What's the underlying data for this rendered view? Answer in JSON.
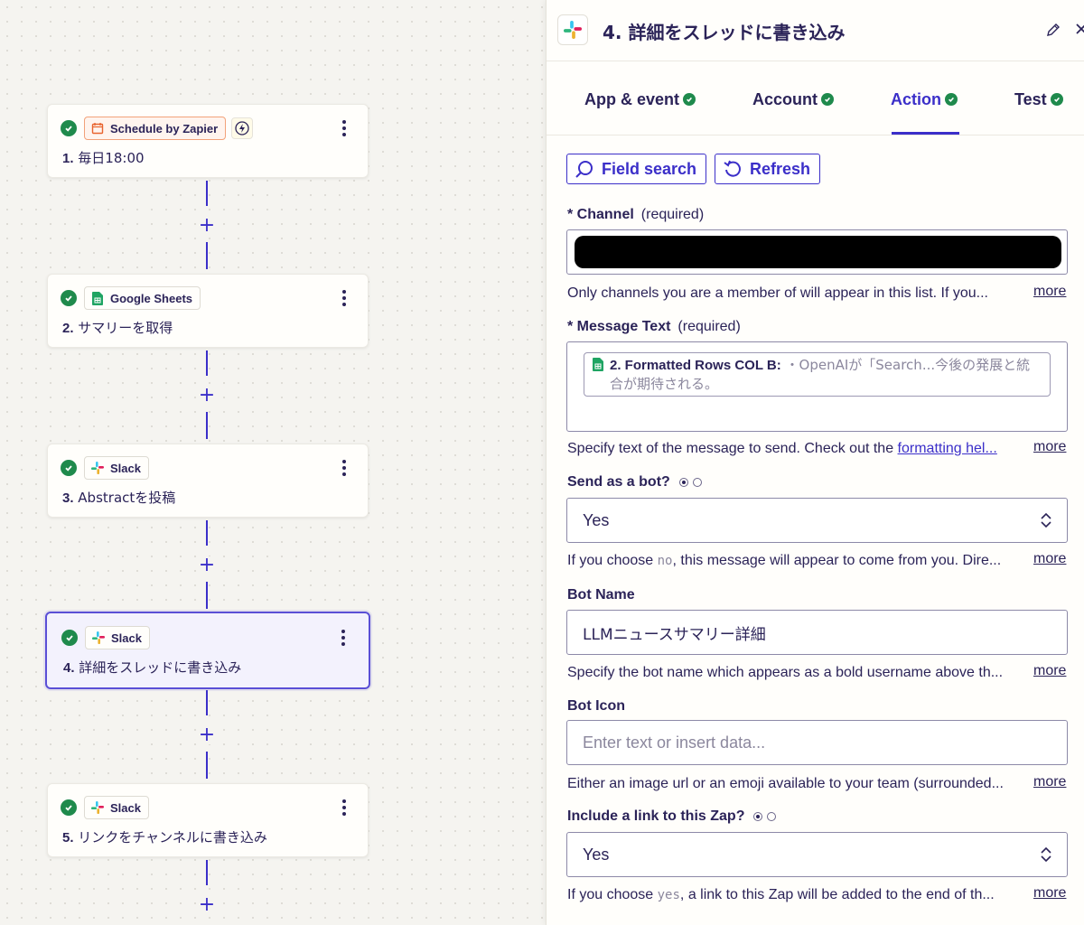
{
  "steps": [
    {
      "app": "Schedule by Zapier",
      "num": "1.",
      "title": "毎日18:00"
    },
    {
      "app": "Google Sheets",
      "num": "2.",
      "title": "サマリーを取得"
    },
    {
      "app": "Slack",
      "num": "3.",
      "title": "Abstractを投稿"
    },
    {
      "app": "Slack",
      "num": "4.",
      "title": "詳細をスレッドに書き込み"
    },
    {
      "app": "Slack",
      "num": "5.",
      "title": "リンクをチャンネルに書き込み"
    }
  ],
  "panel": {
    "title": "4. 詳細をスレッドに書き込み",
    "tabs": [
      "App & event",
      "Account",
      "Action",
      "Test"
    ],
    "active_tab": "Action",
    "field_search_label": "Field search",
    "refresh_label": "Refresh",
    "channel": {
      "label": "Channel",
      "required": "(required)",
      "help": "Only channels you are a member of will appear in this list. If you..."
    },
    "message_text": {
      "label": "Message Text",
      "required": "(required)",
      "pill_title": "2. Formatted Rows COL B:",
      "pill_value": "・OpenAIが「Search...今後の発展と統合が期待される。",
      "help_prefix": "Specify text of the message to send. Check out the ",
      "help_link": "formatting hel..."
    },
    "send_as_bot": {
      "label": "Send as a bot?",
      "value": "Yes",
      "help_pre": "If you choose ",
      "help_code": "no",
      "help_post": ", this message will appear to come from you. Dire..."
    },
    "bot_name": {
      "label": "Bot Name",
      "value": "LLMニュースサマリー詳細",
      "help": "Specify the bot name which appears as a bold username above th..."
    },
    "bot_icon": {
      "label": "Bot Icon",
      "placeholder": "Enter text or insert data...",
      "help": "Either an image url or an emoji available to your team (surrounded..."
    },
    "include_link": {
      "label": "Include a link to this Zap?",
      "value": "Yes",
      "help_pre": "If you choose ",
      "help_code": "yes",
      "help_post": ", a link to this Zap will be added to the end of th..."
    },
    "more_label": "more"
  },
  "colors": {
    "accent": "#3b2fc9",
    "success": "#1f8a4c",
    "text": "#2b2358",
    "selected_border": "#5a4fd6"
  }
}
